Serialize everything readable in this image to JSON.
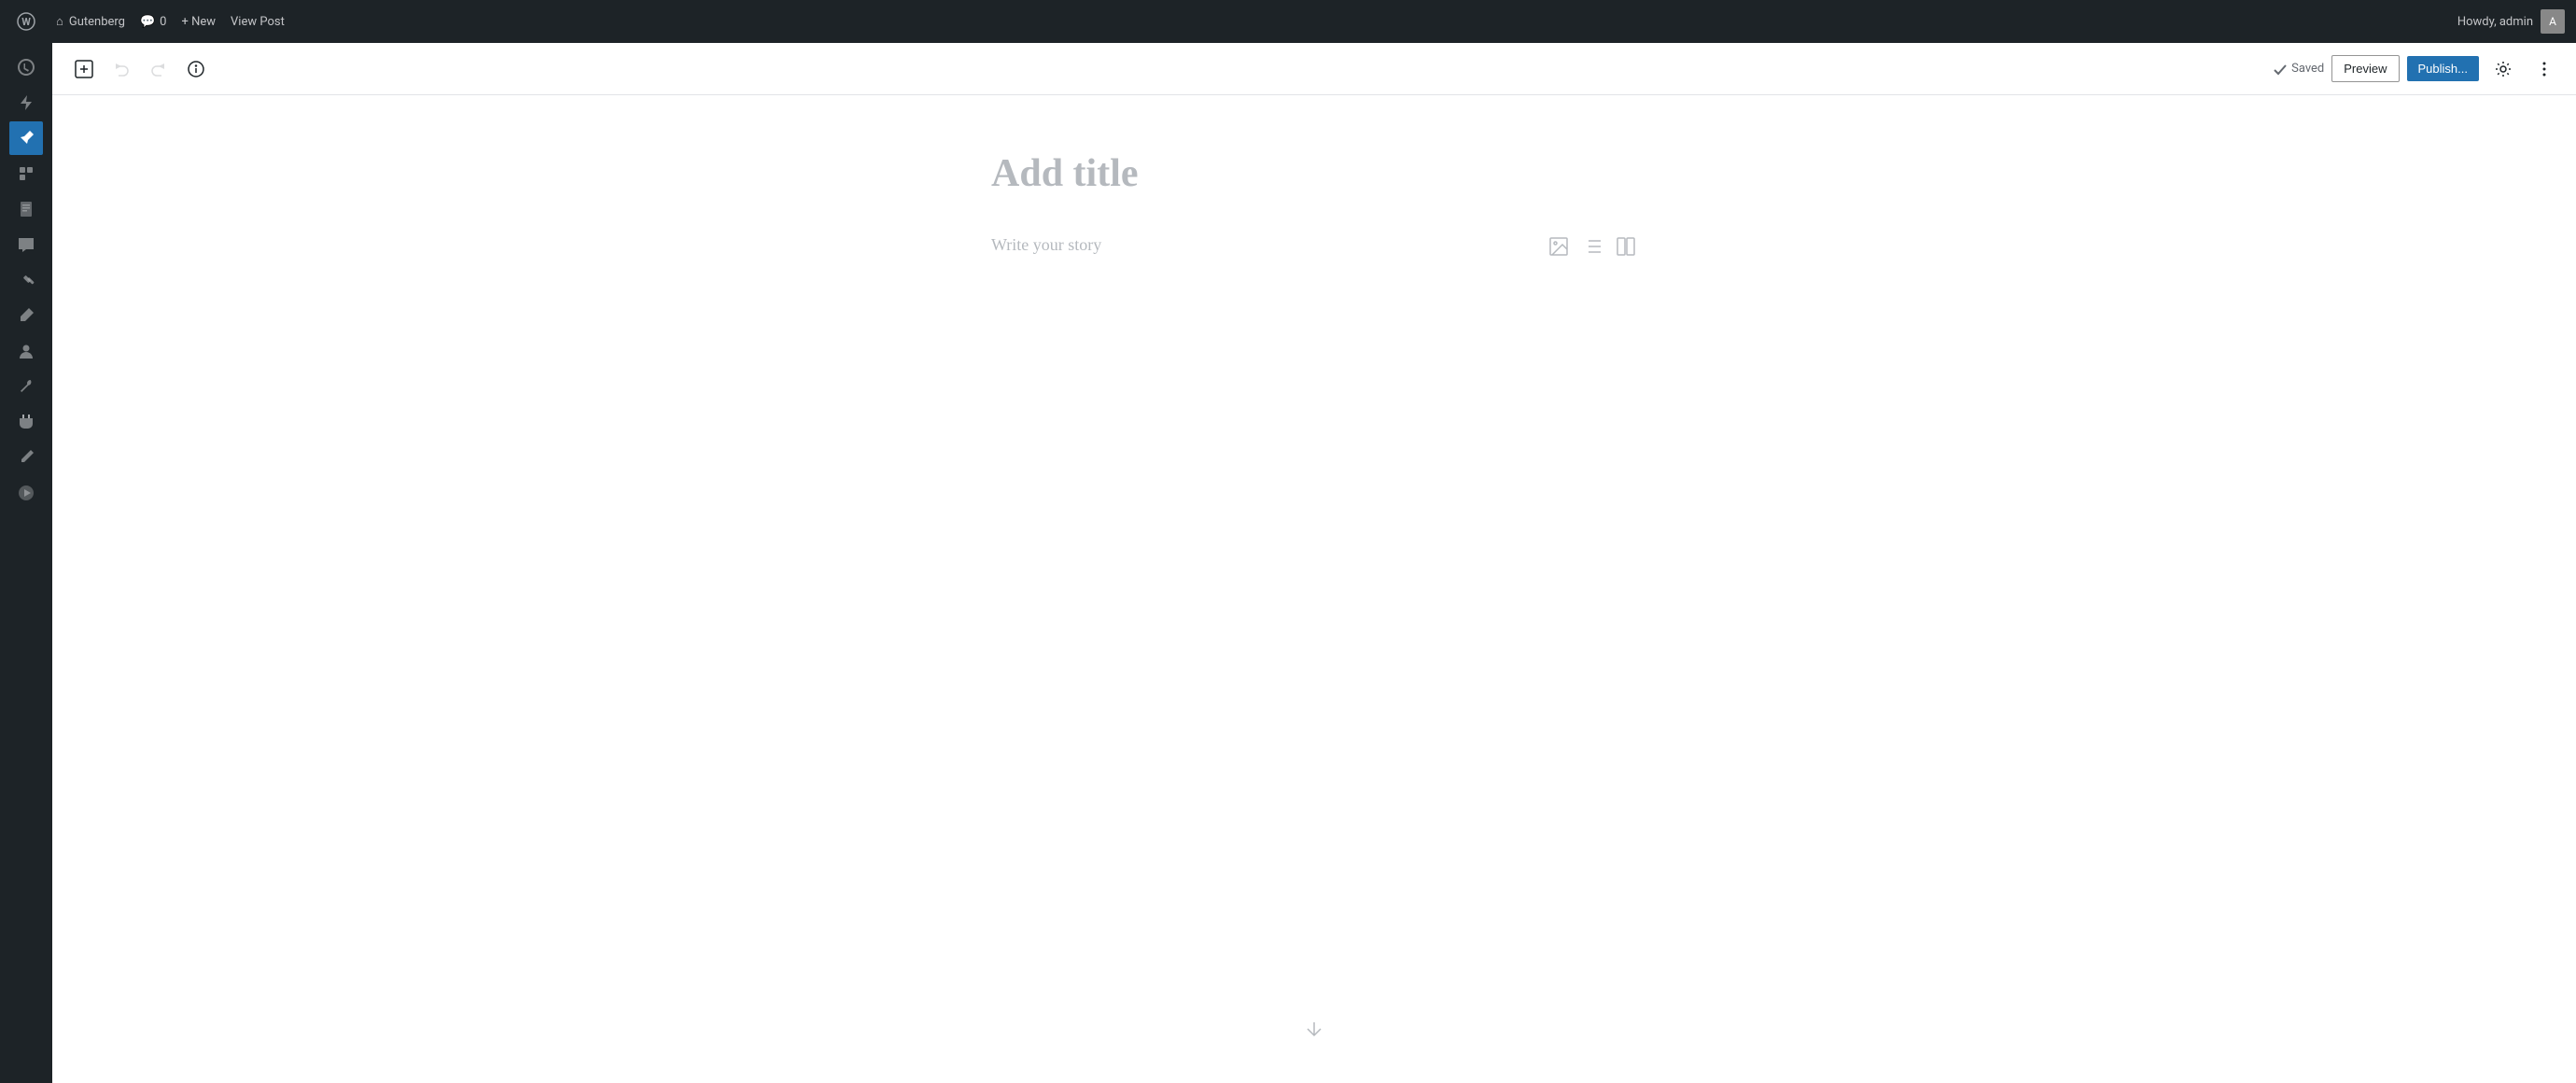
{
  "adminBar": {
    "wpLogo": "W",
    "siteLabel": "Gutenberg",
    "commentsLabel": "0",
    "newLabel": "+ New",
    "viewPostLabel": "View Post",
    "greetingLabel": "Howdy, admin"
  },
  "sidebar": {
    "icons": [
      {
        "name": "dashboard-icon",
        "glyph": "⌂",
        "active": false
      },
      {
        "name": "lightning-icon",
        "glyph": "⚡",
        "active": false
      },
      {
        "name": "pin-icon",
        "glyph": "📌",
        "active": true
      },
      {
        "name": "tools-icon",
        "glyph": "⚙",
        "active": false
      },
      {
        "name": "pages-icon",
        "glyph": "▣",
        "active": false
      },
      {
        "name": "comments-icon",
        "glyph": "💬",
        "active": false
      },
      {
        "name": "hammer-icon",
        "glyph": "🔨",
        "active": false
      },
      {
        "name": "marker-icon",
        "glyph": "✏",
        "active": false
      },
      {
        "name": "user-icon",
        "glyph": "👤",
        "active": false
      },
      {
        "name": "wrench-icon",
        "glyph": "🔧",
        "active": false
      },
      {
        "name": "plugin-icon",
        "glyph": "⬛",
        "active": false
      },
      {
        "name": "edit-icon",
        "glyph": "✒",
        "active": false
      },
      {
        "name": "play-icon",
        "glyph": "▶",
        "active": false
      }
    ]
  },
  "toolbar": {
    "addBlockLabel": "+",
    "undoLabel": "↺",
    "redoLabel": "↻",
    "infoLabel": "ℹ",
    "savedLabel": "Saved",
    "previewLabel": "Preview",
    "publishLabel": "Publish...",
    "settingsLabel": "⚙",
    "moreLabel": "⋮"
  },
  "editor": {
    "titlePlaceholder": "Add title",
    "contentPlaceholder": "Write your story",
    "insertImageIcon": "🖼",
    "insertListIcon": "☰",
    "insertColumnsIcon": "⊞"
  }
}
